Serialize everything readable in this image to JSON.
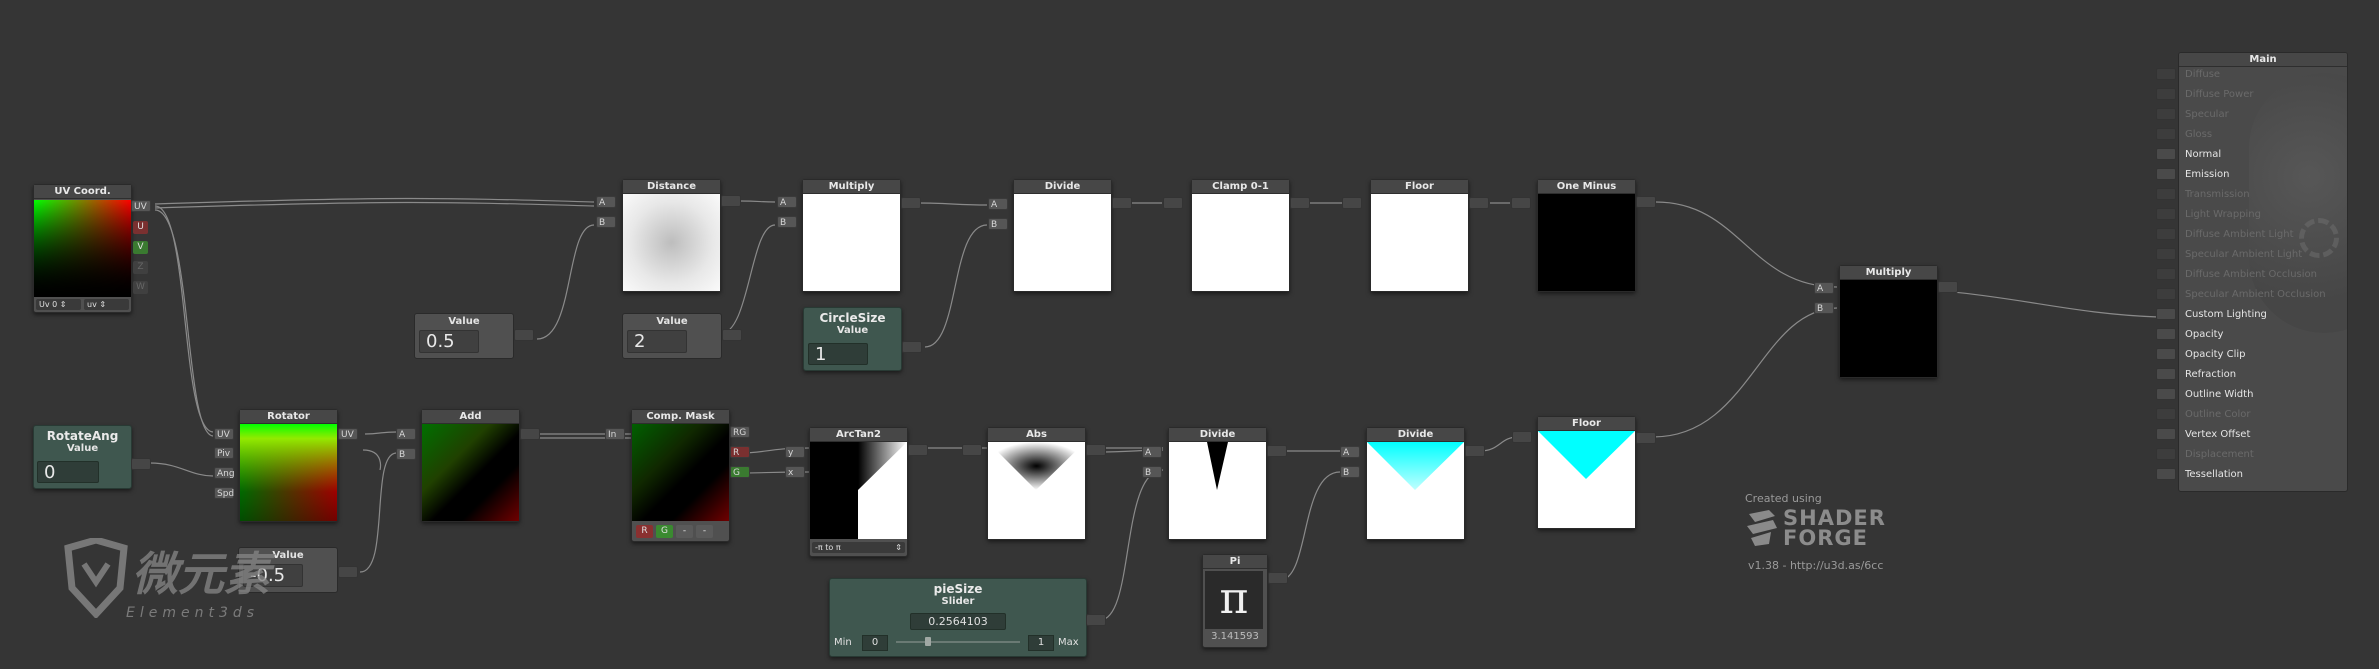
{
  "nodes": {
    "uv_coord": {
      "title": "UV Coord.",
      "out_uv": "UV",
      "out_u": "U",
      "out_v": "V",
      "out_z": "Z",
      "out_w": "W",
      "channel": "Uv 0",
      "mode": "uv"
    },
    "distance": {
      "title": "Distance",
      "in_a": "A",
      "in_b": "B"
    },
    "multiply1": {
      "title": "Multiply",
      "in_a": "A",
      "in_b": "B"
    },
    "divide1": {
      "title": "Divide",
      "in_a": "A",
      "in_b": "B"
    },
    "clamp": {
      "title": "Clamp 0-1"
    },
    "floor1": {
      "title": "Floor"
    },
    "one_minus": {
      "title": "One Minus"
    },
    "multiply2": {
      "title": "Multiply",
      "in_a": "A",
      "in_b": "B"
    },
    "value05": {
      "title": "Value",
      "value": "0.5"
    },
    "value2": {
      "title": "Value",
      "value": "2"
    },
    "circlesize": {
      "title": "CircleSize",
      "sub": "Value",
      "value": "1"
    },
    "rotateang": {
      "title": "RotateAng",
      "sub": "Value",
      "value": "0"
    },
    "rotator": {
      "title": "Rotator",
      "in_uv": "UV",
      "in_piv": "Piv",
      "in_ang": "Ang",
      "in_spd": "Spd",
      "out_uv": "UV"
    },
    "value_neg": {
      "title": "Value",
      "value": "-0.5"
    },
    "add": {
      "title": "Add",
      "in_a": "A",
      "in_b": "B"
    },
    "comp_mask": {
      "title": "Comp. Mask",
      "in": "In",
      "out_rg": "RG",
      "out_r": "R",
      "out_g": "G",
      "btn_r": "R",
      "btn_g": "G",
      "btn_3": "-",
      "btn_4": "-"
    },
    "arctan2": {
      "title": "ArcTan2",
      "in_y": "y",
      "in_x": "x",
      "mode": "-π to π"
    },
    "abs": {
      "title": "Abs"
    },
    "divide2": {
      "title": "Divide",
      "in_a": "A",
      "in_b": "B"
    },
    "divide3": {
      "title": "Divide",
      "in_a": "A",
      "in_b": "B"
    },
    "floor2": {
      "title": "Floor"
    },
    "pi": {
      "title": "Pi",
      "glyph": "π",
      "value": "3.141593"
    },
    "piesize": {
      "title": "pieSize",
      "sub": "Slider",
      "value": "0.2564103",
      "min_label": "Min",
      "min": "0",
      "max": "1",
      "max_label": "Max"
    }
  },
  "main": {
    "title": "Main",
    "inputs": [
      {
        "label": "Diffuse",
        "active": false
      },
      {
        "label": "Diffuse Power",
        "active": false
      },
      {
        "label": "Specular",
        "active": false
      },
      {
        "label": "Gloss",
        "active": false
      },
      {
        "label": "Normal",
        "active": true
      },
      {
        "label": "Emission",
        "active": true
      },
      {
        "label": "Transmission",
        "active": false
      },
      {
        "label": "Light Wrapping",
        "active": false
      },
      {
        "label": "Diffuse Ambient Light",
        "active": false
      },
      {
        "label": "Specular Ambient Light",
        "active": false
      },
      {
        "label": "Diffuse Ambient Occlusion",
        "active": false
      },
      {
        "label": "Specular Ambient Occlusion",
        "active": false
      },
      {
        "label": "Custom Lighting",
        "active": true
      },
      {
        "label": "Opacity",
        "active": true
      },
      {
        "label": "Opacity Clip",
        "active": true
      },
      {
        "label": "Refraction",
        "active": true
      },
      {
        "label": "Outline Width",
        "active": true
      },
      {
        "label": "Outline Color",
        "active": false
      },
      {
        "label": "Vertex Offset",
        "active": true
      },
      {
        "label": "Displacement",
        "active": false
      },
      {
        "label": "Tessellation",
        "active": true
      }
    ]
  },
  "branding": {
    "created_using": "Created using",
    "logo_line1": "SHADER",
    "logo_line2": "FORGE",
    "version": "v1.38 - http://u3d.as/6cc"
  },
  "watermark": {
    "cn": "微元素",
    "en": "Element3ds"
  },
  "colors": {
    "wire": "#8a8a8a",
    "node_bg": "#505050",
    "green_node": "#3f574f",
    "cyan": "#00ffff"
  }
}
